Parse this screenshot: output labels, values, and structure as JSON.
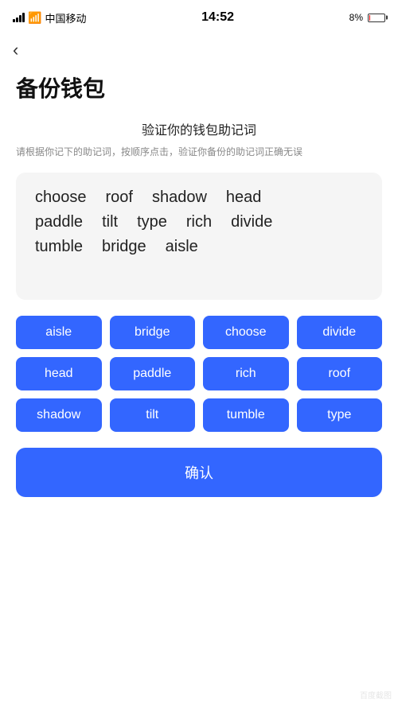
{
  "statusBar": {
    "carrier": "中国移动",
    "time": "14:52",
    "batteryPercent": "8%"
  },
  "backButton": {
    "label": "‹"
  },
  "page": {
    "title": "备份钱包",
    "sectionTitle": "验证你的钱包助记词",
    "sectionDesc": "请根据你记下的助记词，按顺序点击，验证你备份的助记词正确无误"
  },
  "wordCard": {
    "rows": [
      [
        "choose",
        "roof",
        "shadow",
        "head"
      ],
      [
        "paddle",
        "tilt",
        "type",
        "rich",
        "divide"
      ],
      [
        "tumble",
        "bridge",
        "aisle"
      ]
    ]
  },
  "wordButtons": [
    "aisle",
    "bridge",
    "choose",
    "divide",
    "head",
    "paddle",
    "rich",
    "roof",
    "shadow",
    "tilt",
    "tumble",
    "type"
  ],
  "confirmButton": {
    "label": "确认"
  },
  "watermark": "Baidu"
}
